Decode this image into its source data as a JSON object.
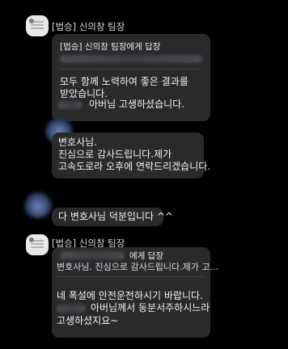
{
  "messages": [
    {
      "sender": "[법승] 신의창 팀장",
      "reply_header": "[법승] 신의창 팀장에게 답장",
      "lines": [
        "모두 함께 노력하여 좋은 결과를",
        "받았습니다.",
        "아버님 고생하셨습니다."
      ]
    },
    {
      "lines": [
        "변호사님.",
        "진심으로 감사드립니다.제가",
        "고속도로라 오후에 연락드리겠습니다."
      ]
    },
    {
      "lines": [
        "다 변호사님 덕분입니다 ^^"
      ]
    },
    {
      "sender": "[법승] 신의창 팀장",
      "reply_header": "에게 답장",
      "reply_preview": "변호사님. 진심으로 감사드립니다.제가 고...",
      "lines": [
        "네 폭설에 안전운전하시기 바랍니다.",
        "아버님께서 동분서주하시느라",
        "고생하셨지요~"
      ]
    }
  ]
}
